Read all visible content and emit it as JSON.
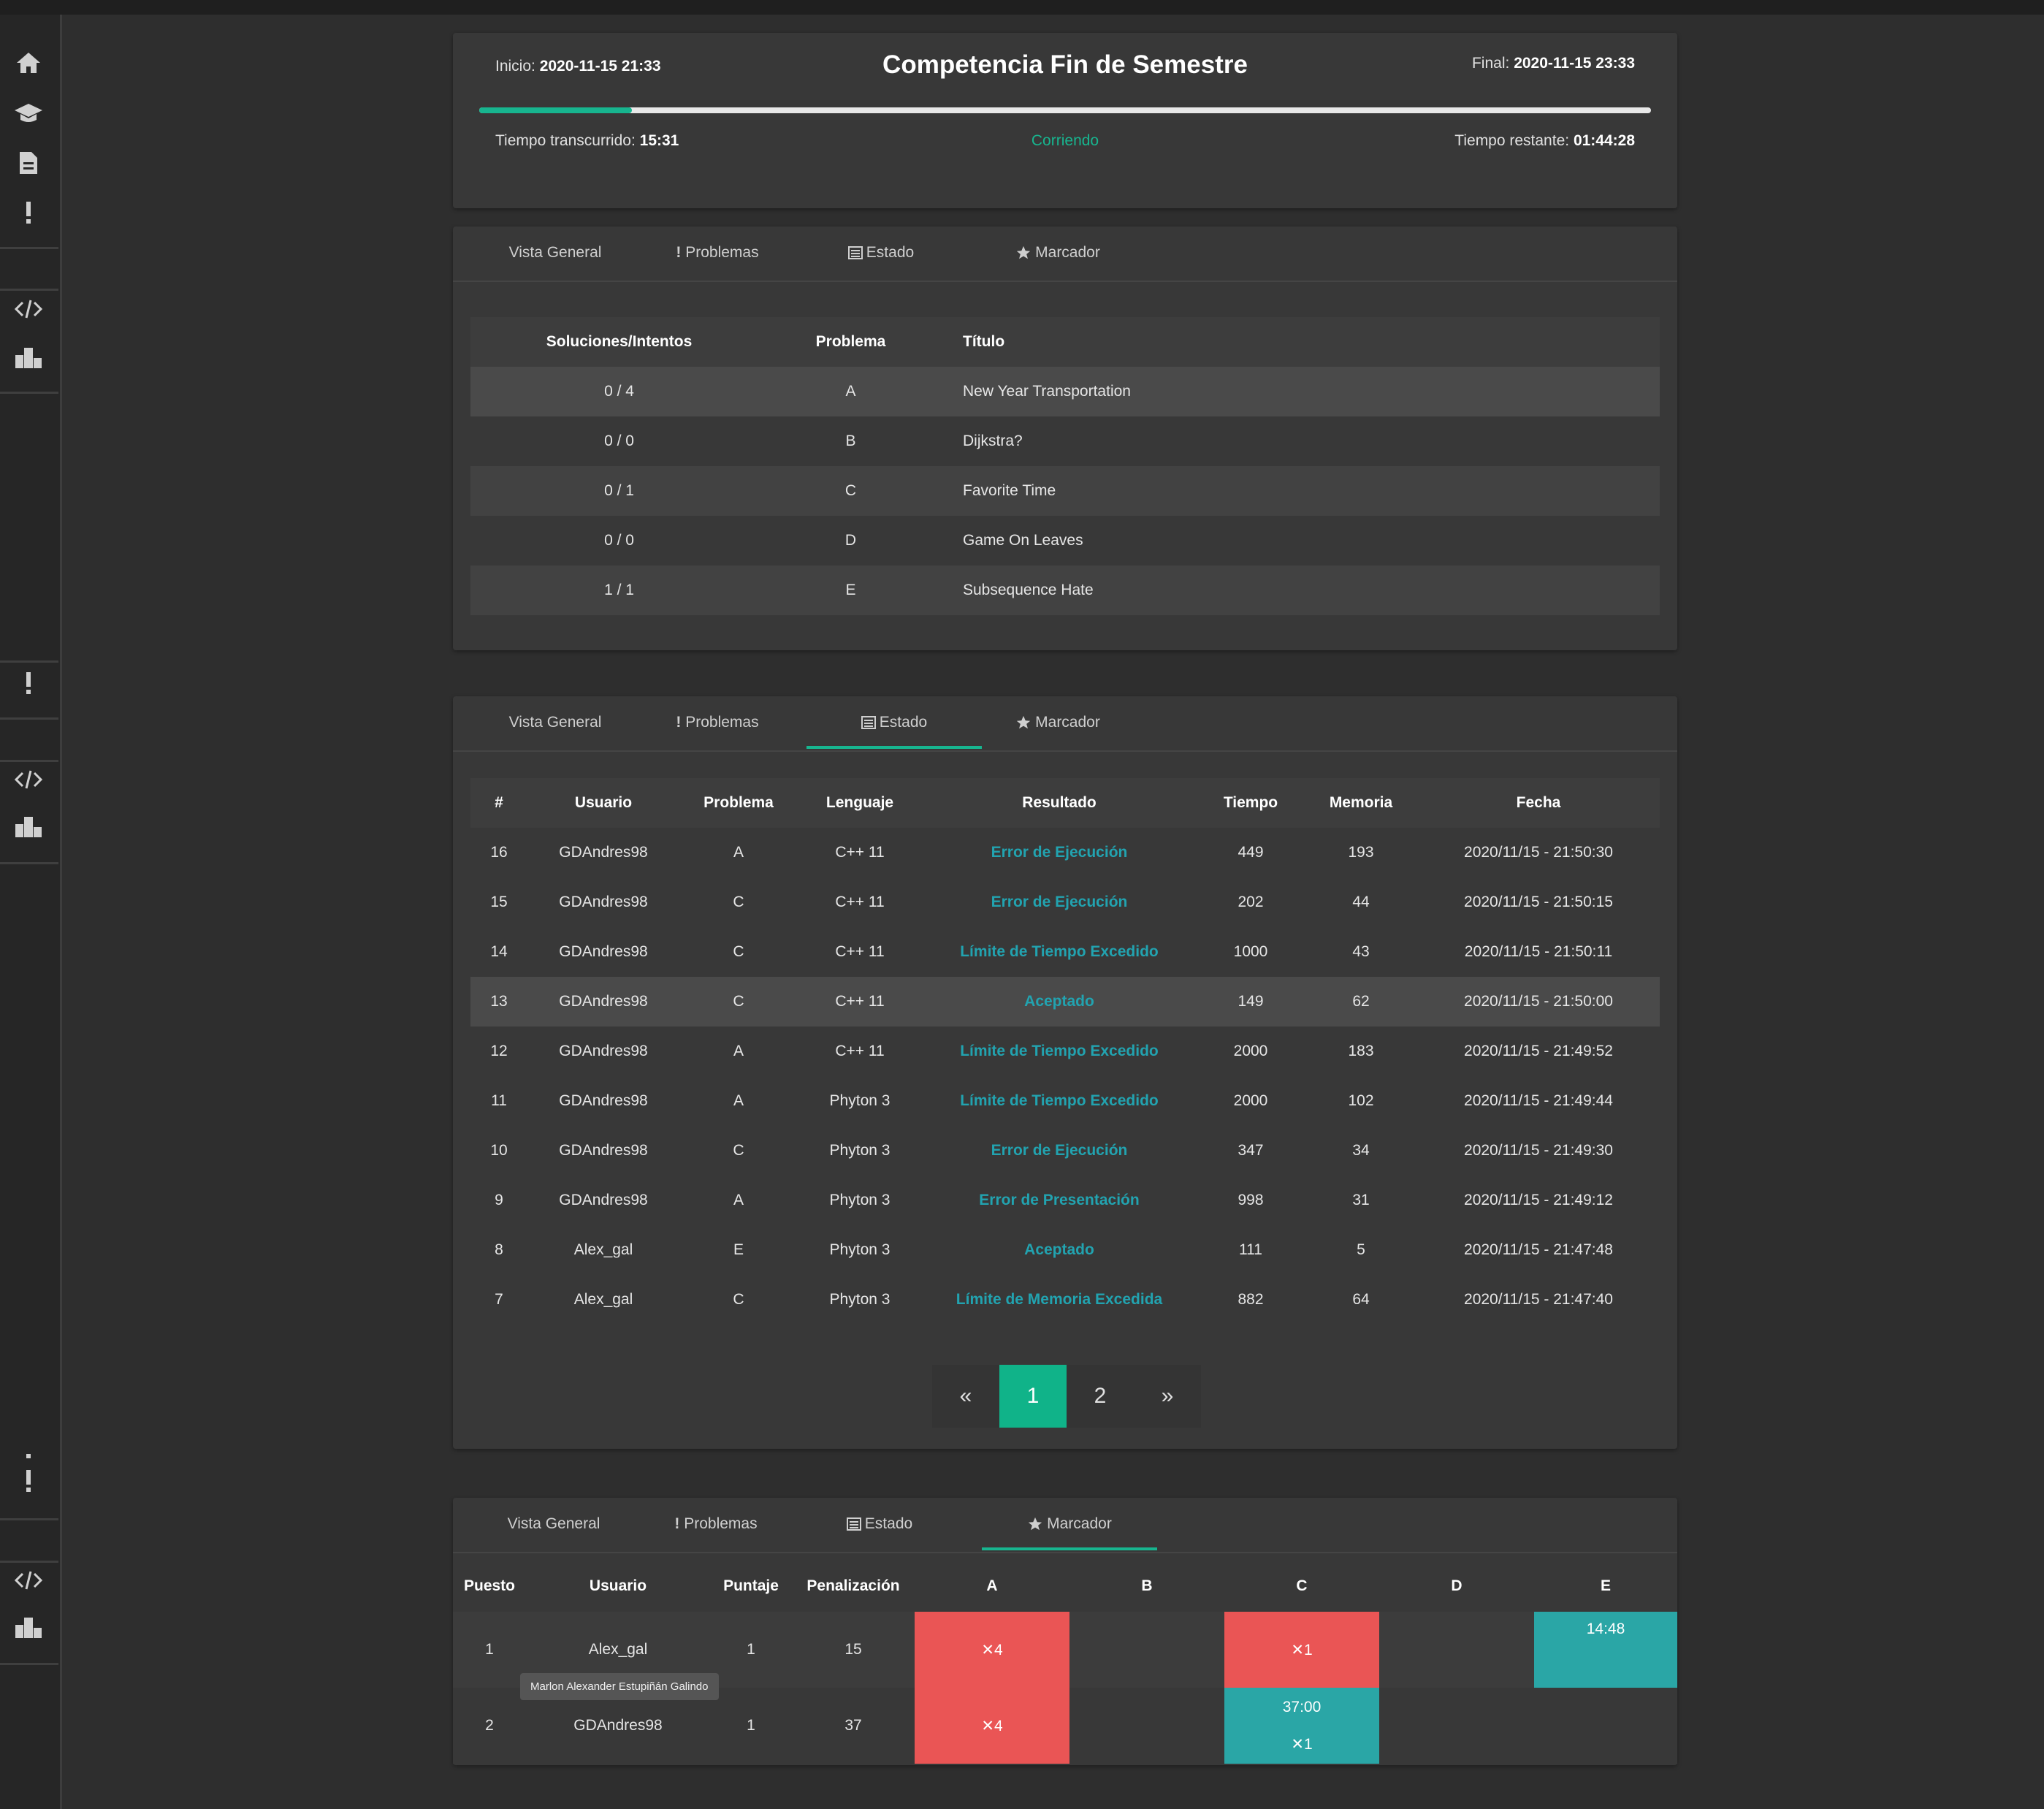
{
  "contest": {
    "title": "Competencia Fin de Semestre",
    "start_label": "Inicio:",
    "start_value": "2020-11-15 21:33",
    "end_label": "Final:",
    "end_value": "2020-11-15 23:33",
    "elapsed_label": "Tiempo transcurrido:",
    "elapsed_value": "15:31",
    "status": "Corriendo",
    "remaining_label": "Tiempo restante:",
    "remaining_value": "01:44:28",
    "progress_fraction": 0.13
  },
  "tabs": [
    "Vista General",
    "Problemas",
    "Estado",
    "Marcador"
  ],
  "problems": {
    "headers": [
      "Soluciones/Intentos",
      "Problema",
      "Título"
    ],
    "rows": [
      {
        "sol": "0 / 4",
        "prob": "A",
        "title": "New Year Transportation"
      },
      {
        "sol": "0 / 0",
        "prob": "B",
        "title": "Dijkstra?"
      },
      {
        "sol": "0 / 1",
        "prob": "C",
        "title": "Favorite Time"
      },
      {
        "sol": "0 / 0",
        "prob": "D",
        "title": "Game On Leaves"
      },
      {
        "sol": "1 / 1",
        "prob": "E",
        "title": "Subsequence Hate"
      }
    ]
  },
  "status": {
    "headers": [
      "#",
      "Usuario",
      "Problema",
      "Lenguaje",
      "Resultado",
      "Tiempo",
      "Memoria",
      "Fecha"
    ],
    "rows": [
      {
        "id": "16",
        "user": "GDAndres98",
        "prob": "A",
        "lang": "C++ 11",
        "result": "Error de Ejecución",
        "time": "449",
        "mem": "193",
        "date": "2020/11/15 - 21:50:30"
      },
      {
        "id": "15",
        "user": "GDAndres98",
        "prob": "C",
        "lang": "C++ 11",
        "result": "Error de Ejecución",
        "time": "202",
        "mem": "44",
        "date": "2020/11/15 - 21:50:15"
      },
      {
        "id": "14",
        "user": "GDAndres98",
        "prob": "C",
        "lang": "C++ 11",
        "result": "Límite de Tiempo Excedido",
        "time": "1000",
        "mem": "43",
        "date": "2020/11/15 - 21:50:11"
      },
      {
        "id": "13",
        "user": "GDAndres98",
        "prob": "C",
        "lang": "C++ 11",
        "result": "Aceptado",
        "time": "149",
        "mem": "62",
        "date": "2020/11/15 - 21:50:00"
      },
      {
        "id": "12",
        "user": "GDAndres98",
        "prob": "A",
        "lang": "C++ 11",
        "result": "Límite de Tiempo Excedido",
        "time": "2000",
        "mem": "183",
        "date": "2020/11/15 - 21:49:52"
      },
      {
        "id": "11",
        "user": "GDAndres98",
        "prob": "A",
        "lang": "Phyton 3",
        "result": "Límite de Tiempo Excedido",
        "time": "2000",
        "mem": "102",
        "date": "2020/11/15 - 21:49:44"
      },
      {
        "id": "10",
        "user": "GDAndres98",
        "prob": "C",
        "lang": "Phyton 3",
        "result": "Error de Ejecución",
        "time": "347",
        "mem": "34",
        "date": "2020/11/15 - 21:49:30"
      },
      {
        "id": "9",
        "user": "GDAndres98",
        "prob": "A",
        "lang": "Phyton 3",
        "result": "Error de Presentación",
        "time": "998",
        "mem": "31",
        "date": "2020/11/15 - 21:49:12"
      },
      {
        "id": "8",
        "user": "Alex_gal",
        "prob": "E",
        "lang": "Phyton 3",
        "result": "Aceptado",
        "time": "111",
        "mem": "5",
        "date": "2020/11/15 - 21:47:48"
      },
      {
        "id": "7",
        "user": "Alex_gal",
        "prob": "C",
        "lang": "Phyton 3",
        "result": "Límite de Memoria Excedida",
        "time": "882",
        "mem": "64",
        "date": "2020/11/15 - 21:47:40"
      }
    ],
    "pagination": {
      "prev": "«",
      "pages": [
        "1",
        "2"
      ],
      "next": "»"
    }
  },
  "scoreboard": {
    "headers": [
      "Puesto",
      "Usuario",
      "Puntaje",
      "Penalización",
      "A",
      "B",
      "C",
      "D",
      "E"
    ],
    "row1": {
      "rank": "1",
      "user": "Alex_gal",
      "score": "1",
      "penalty": "15",
      "a_tries": "4",
      "c_tries": "1",
      "e_time": "14:48"
    },
    "row2": {
      "rank": "2",
      "user": "GDAndres98",
      "score": "1",
      "penalty": "37",
      "a_tries": "4",
      "c_time": "37:00",
      "c_tries": "1"
    },
    "tooltip": "Marlon Alexander Estupiñán Galindo"
  },
  "colors": {
    "accent": "#17b58f",
    "result": "#22a3b0",
    "fail": "#ea5555",
    "solved": "#2aa6a6"
  }
}
